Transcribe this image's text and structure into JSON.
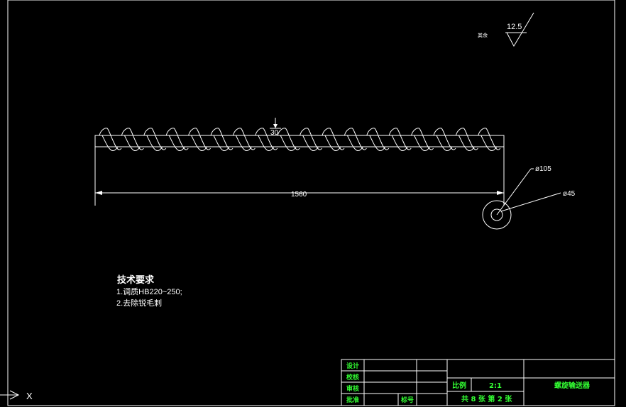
{
  "roughness": {
    "value": "12.5",
    "note": "其余"
  },
  "dimensions": {
    "pitch_height": "30",
    "length": "1560",
    "outer_diameter": "ø105",
    "shaft_diameter": "ø45"
  },
  "tech_requirements": {
    "title": "技术要求",
    "line1": "1.调质HB220~250;",
    "line2": "2.去除锐毛刺"
  },
  "title_block": {
    "row_labels": [
      "设计",
      "校核",
      "审核",
      "批准"
    ],
    "label_count": "标号",
    "label_scale": "比例",
    "scale": "2:1",
    "part_name": "螺旋输送器",
    "sheets": "共 8 张  第 2 张"
  },
  "ucs": {
    "x_label": "X"
  },
  "colors": {
    "lines": "#ffffff",
    "title_text": "#33ff33",
    "background": "#000000"
  }
}
